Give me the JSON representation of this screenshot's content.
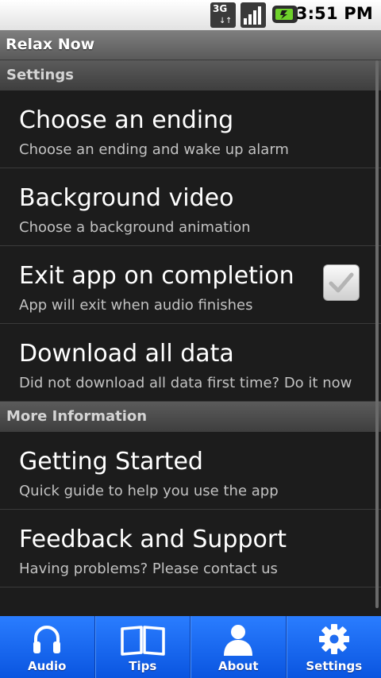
{
  "status_bar": {
    "network_label": "3G",
    "time": "3:51 PM",
    "icons": [
      "3g-data-icon",
      "signal-strength-icon",
      "battery-icon"
    ]
  },
  "app_title": "Relax Now",
  "sections": [
    {
      "header": "Settings",
      "items": [
        {
          "title": "Choose an ending",
          "summary": "Choose an ending and wake up alarm"
        },
        {
          "title": "Background video",
          "summary": "Choose a background animation"
        },
        {
          "title": "Exit app on completion",
          "summary": "App will exit when audio finishes",
          "checked": true
        },
        {
          "title": "Download all data",
          "summary": "Did not download all data first time? Do it now"
        }
      ]
    },
    {
      "header": "More Information",
      "items": [
        {
          "title": "Getting Started",
          "summary": "Quick guide to help you use the app"
        },
        {
          "title": "Feedback and Support",
          "summary": "Having problems? Please contact us"
        }
      ]
    }
  ],
  "tabs": [
    {
      "label": "Audio",
      "icon": "headphones-icon"
    },
    {
      "label": "Tips",
      "icon": "book-icon"
    },
    {
      "label": "About",
      "icon": "person-icon"
    },
    {
      "label": "Settings",
      "icon": "gear-icon"
    }
  ],
  "colors": {
    "tab_bar": "#1f6cf0",
    "title_bar": "#6b6b6b",
    "list_bg": "#1c1c1c"
  }
}
